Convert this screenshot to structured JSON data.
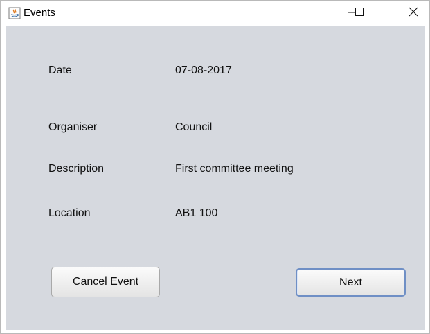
{
  "window": {
    "title": "Events"
  },
  "fields": {
    "date": {
      "label": "Date",
      "value": "07-08-2017"
    },
    "organiser": {
      "label": "Organiser",
      "value": "Council"
    },
    "description": {
      "label": "Description",
      "value": "First committee meeting"
    },
    "location": {
      "label": "Location",
      "value": "AB1 100"
    }
  },
  "buttons": {
    "cancel_label": "Cancel Event",
    "next_label": "Next"
  },
  "colors": {
    "content_background": "#d6d9df",
    "focus_border": "#6f8fc5"
  },
  "icons": {
    "app": "java-app-icon",
    "minimize": "minimize-icon",
    "maximize": "maximize-icon",
    "close": "close-icon"
  }
}
